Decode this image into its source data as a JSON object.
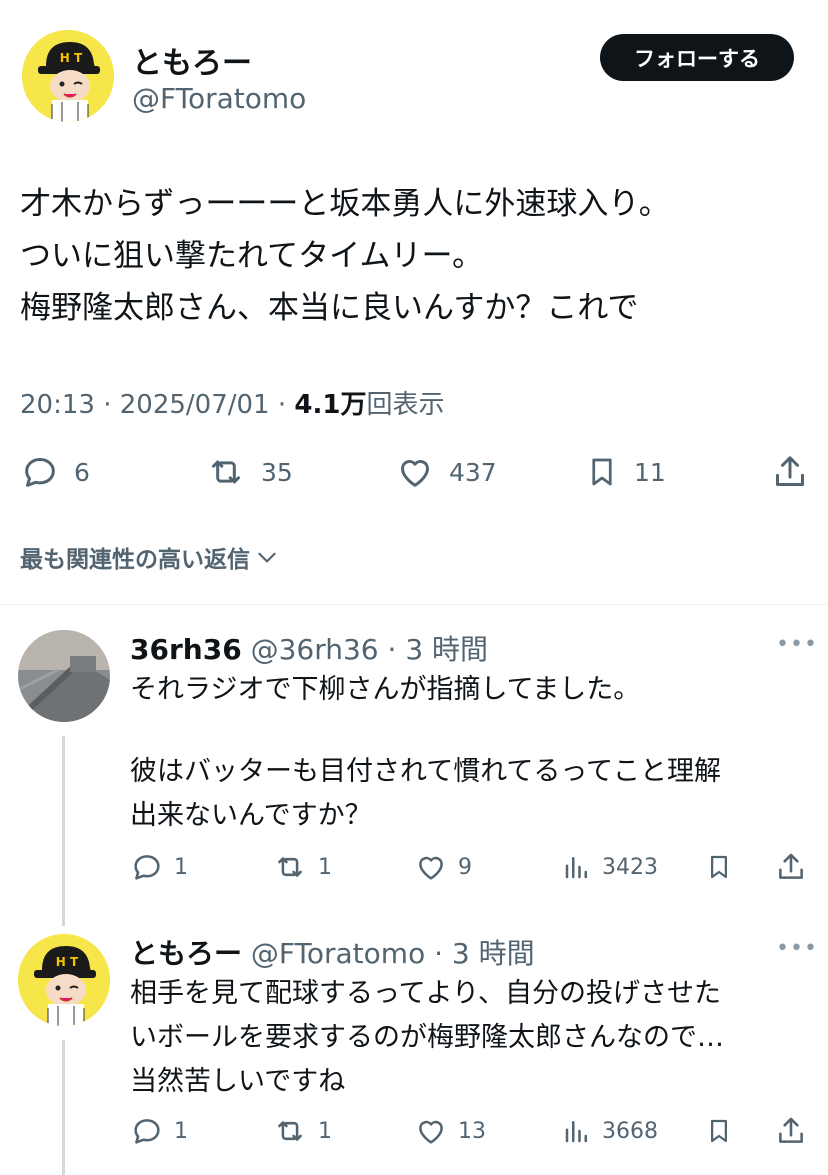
{
  "main": {
    "author_name": "ともろー",
    "author_handle": "@FToratomo",
    "follow_label": "フォローする",
    "text_lines": [
      "才木からずっーーーと坂本勇人に外速球入り。",
      "ついに狙い撃たれてタイムリー。",
      "梅野隆太郎さん、本当に良いんすか？これで"
    ],
    "time": "20:13",
    "date": "2025/07/01",
    "views_count": "4.1万",
    "views_label": "回表示",
    "actions": {
      "replies": "6",
      "retweets": "35",
      "likes": "437",
      "bookmarks": "11"
    }
  },
  "sort_label": "最も関連性の高い返信",
  "replies": [
    {
      "name": "36rh36",
      "handle": "@36rh36",
      "time": "3 時間",
      "text_lines": [
        "それラジオで下柳さんが指摘してました。",
        "",
        "彼はバッターも目付されて慣れてるってこと理解",
        "出来ないんですか？"
      ],
      "actions": {
        "replies": "1",
        "retweets": "1",
        "likes": "9",
        "views": "3423"
      }
    },
    {
      "name": "ともろー",
      "handle": "@FToratomo",
      "time": "3 時間",
      "text_lines": [
        "相手を見て配球するってより、自分の投げさせた",
        "いボールを要求するのが梅野隆太郎さんなので…",
        "当然苦しいですね"
      ],
      "actions": {
        "replies": "1",
        "retweets": "1",
        "likes": "13",
        "views": "3668"
      }
    }
  ],
  "colors": {
    "accent_text": "#0f1419",
    "muted": "#536471",
    "avatar_bg": "#f7e64a"
  }
}
